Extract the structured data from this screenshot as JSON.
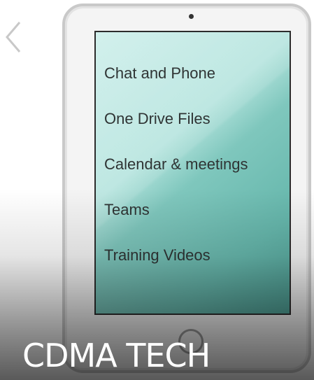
{
  "menu": {
    "items": [
      {
        "label": "Chat and Phone"
      },
      {
        "label": "One Drive Files"
      },
      {
        "label": "Calendar & meetings"
      },
      {
        "label": "Teams"
      },
      {
        "label": "Training Videos"
      }
    ]
  },
  "brand": {
    "text": "CDMA TECH"
  },
  "icons": {
    "back": "chevron-left-icon"
  },
  "colors": {
    "screen_top": "#c3ebe6",
    "screen_bottom": "#4f9f95",
    "menu_text": "#2f3434",
    "brand_text": "#ffffff"
  }
}
